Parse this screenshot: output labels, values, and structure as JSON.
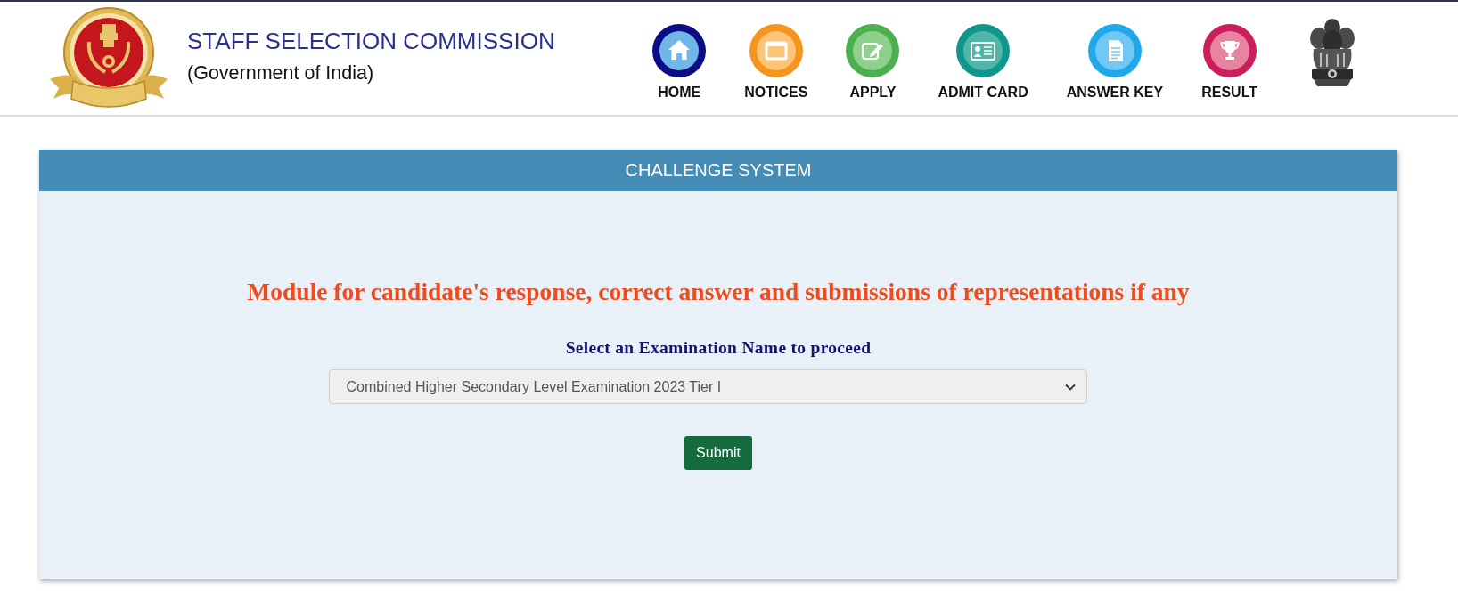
{
  "header": {
    "title": "STAFF SELECTION COMMISSION",
    "subtitle": "(Government of India)"
  },
  "nav": [
    {
      "label": "HOME",
      "kind": "home",
      "color": "#0c0c86"
    },
    {
      "label": "NOTICES",
      "kind": "notices",
      "color": "#f7941d"
    },
    {
      "label": "APPLY",
      "kind": "apply",
      "color": "#4caf50"
    },
    {
      "label": "ADMIT CARD",
      "kind": "admit_card",
      "color": "#10968a"
    },
    {
      "label": "ANSWER KEY",
      "kind": "answer_key",
      "color": "#1fa9ea"
    },
    {
      "label": "RESULT",
      "kind": "result",
      "color": "#cc1d5c"
    }
  ],
  "panel": {
    "title": "CHALLENGE SYSTEM",
    "heading": "Module for candidate's response, correct answer and submissions of representations if any",
    "select_label": "Select an Examination Name to proceed",
    "exam_select": {
      "value": "Combined Higher Secondary Level Examination 2023 Tier I"
    },
    "submit_button": "Submit"
  }
}
